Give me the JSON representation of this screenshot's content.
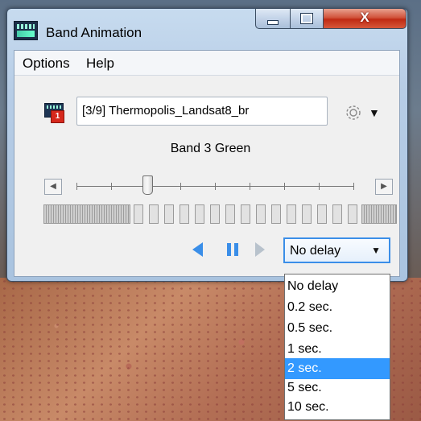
{
  "window": {
    "title": "Band Animation",
    "controls": {
      "minimize": "minimize",
      "maximize": "maximize",
      "close": "X"
    }
  },
  "menu": {
    "options": "Options",
    "help": "Help"
  },
  "file": {
    "value": "[3/9] Thermopolis_Landsat8_br",
    "badge": "1"
  },
  "band": {
    "label": "Band 3 Green"
  },
  "slider": {
    "position": 3,
    "count": 9
  },
  "icons": {
    "app": "band-animation-app-icon",
    "file": "raster-file-icon",
    "settings": "gear-icon",
    "prev": "step-back-icon",
    "pause": "pause-icon",
    "next": "step-forward-icon"
  },
  "delay": {
    "selected": "No delay",
    "options": [
      "No delay",
      "0.2 sec.",
      "0.5 sec.",
      "1 sec.",
      "2 sec.",
      "5 sec.",
      "10 sec."
    ],
    "highlighted": "2 sec."
  },
  "colors": {
    "highlight": "#3399ff",
    "playback_blue": "#3a8ee8"
  }
}
